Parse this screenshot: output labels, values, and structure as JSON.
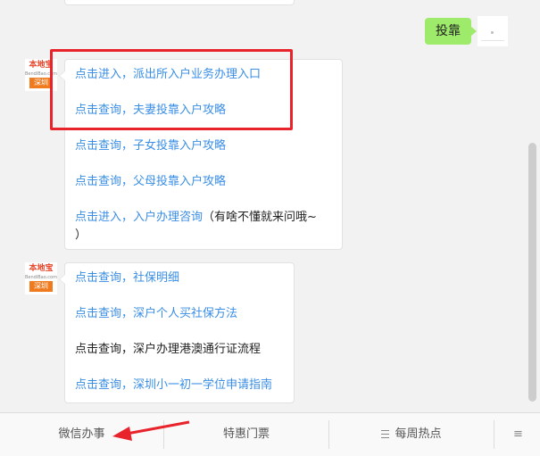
{
  "chat": {
    "user_message": "投靠",
    "bot_avatar": {
      "brand": "本地宝",
      "site": "BendiBao.com",
      "city": "深圳"
    },
    "message1": {
      "links": [
        "点击进入，派出所入户业务办理入口",
        "点击查询，夫妻投靠入户攻略",
        "点击查询，子女投靠入户攻略",
        "点击查询，父母投靠入户攻略"
      ],
      "last_link": "点击进入，入户办理咨询",
      "last_suffix": "（有啥不懂就来问哦~",
      "last_suffix_2": "）"
    },
    "message2": {
      "links": [
        "点击查询，社保明细",
        "点击查询，深户个人买社保方法",
        "点击查询，深户办理港澳通行证流程",
        "点击查询，深圳小一初一学位申请指南"
      ]
    }
  },
  "menu": {
    "items": [
      "微信办事",
      "特惠门票",
      "每周热点"
    ],
    "toggle_icon": "≡"
  },
  "colors": {
    "link": "#3a8ee6",
    "user_bubble": "#9eea6a",
    "highlight": "#e8232b",
    "brand_orange": "#f07b1f"
  }
}
